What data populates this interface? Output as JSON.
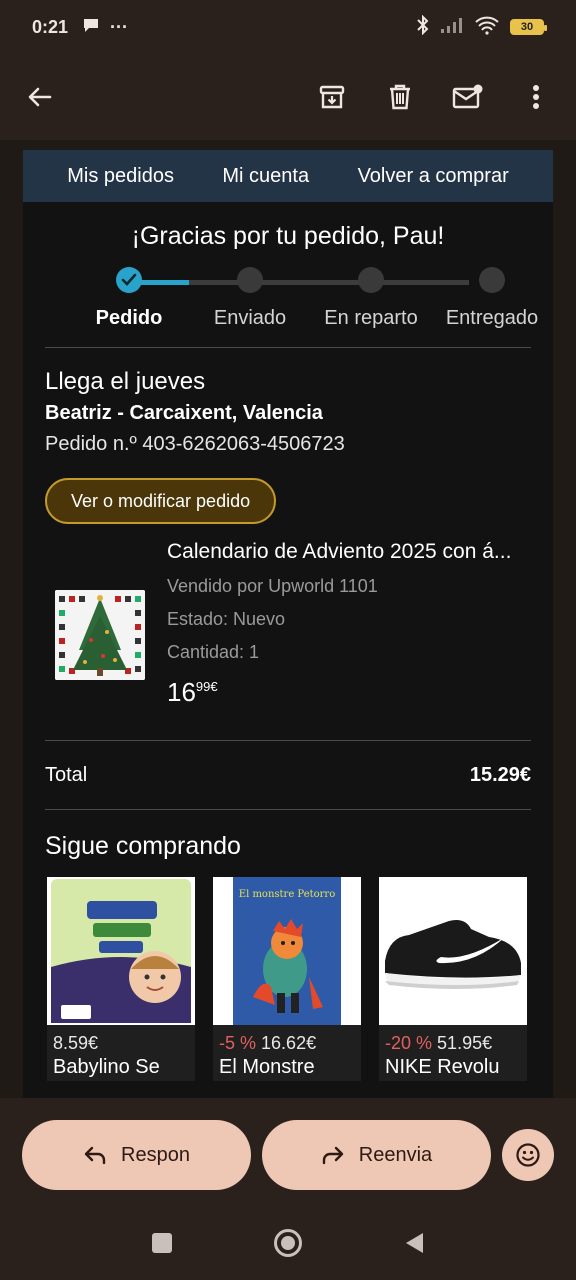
{
  "status": {
    "time": "0:21",
    "battery": "30"
  },
  "email": {
    "nav": [
      "Mis pedidos",
      "Mi cuenta",
      "Volver a comprar"
    ],
    "thanks": "¡Gracias por tu pedido, Pau!",
    "steps": [
      "Pedido",
      "Enviado",
      "En reparto",
      "Entregado"
    ],
    "arrival_title": "Llega el jueves",
    "address": "Beatriz - Carcaixent, Valencia",
    "order_number": "Pedido n.º 403-6262063-4506723",
    "modify_button": "Ver o modificar pedido",
    "item": {
      "title": "Calendario de Adviento 2025 con á...",
      "seller": "Vendido por Upworld 1101",
      "condition": "Estado: Nuevo",
      "quantity": "Cantidad: 1",
      "price_int": "16",
      "price_dec": "99€"
    },
    "total_label": "Total",
    "total_value": "15.29€",
    "keep_shopping": "Sigue comprando",
    "products": [
      {
        "discount": "",
        "price": "8.59€",
        "name": "Babylino Se"
      },
      {
        "discount": "-5 %",
        "price": "16.62€",
        "name": "El Monstre"
      },
      {
        "discount": "-20 %",
        "price": "51.95€",
        "name": "NIKE Revolu"
      }
    ],
    "book_title": "El monstre Petorro"
  },
  "actions": {
    "reply": "Respon",
    "forward": "Reenvia"
  },
  "colors": {
    "accent_progress": "#29a3c9",
    "nav_bg": "#243447",
    "pill_bg": "#eec7b5",
    "discount": "#e06060"
  }
}
